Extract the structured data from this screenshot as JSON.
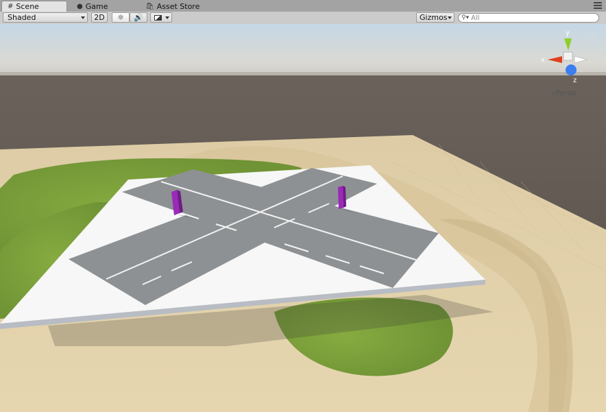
{
  "tabs": [
    {
      "label": "Scene",
      "icon": "grid-icon",
      "active": true
    },
    {
      "label": "Game",
      "icon": "pacman-icon",
      "active": false
    },
    {
      "label": "Asset Store",
      "icon": "shopping-bag-icon",
      "active": false
    }
  ],
  "toolbar": {
    "draw_mode": "Shaded",
    "mode_2d": "2D",
    "lighting_icon": "sun-icon",
    "audio_icon": "speaker-icon",
    "effects_icon": "image-icon",
    "gizmos_label": "Gizmos",
    "search_placeholder": "All"
  },
  "gizmo": {
    "x_label": "x",
    "y_label": "y",
    "z_label": "z",
    "projection_label": "Persp",
    "colors": {
      "x": "#e0401f",
      "y": "#8dd02a",
      "z": "#3a7ef0"
    }
  },
  "scene_colors": {
    "sky_top": "#c8dbe8",
    "horizon": "#d7d6d0",
    "ground": "#5c534c",
    "sand": "#e3d2aa",
    "grass": "#7ea33c",
    "platform": "#f7f7f7",
    "road": "#8e9193",
    "pillar": "#9a2ab8"
  }
}
